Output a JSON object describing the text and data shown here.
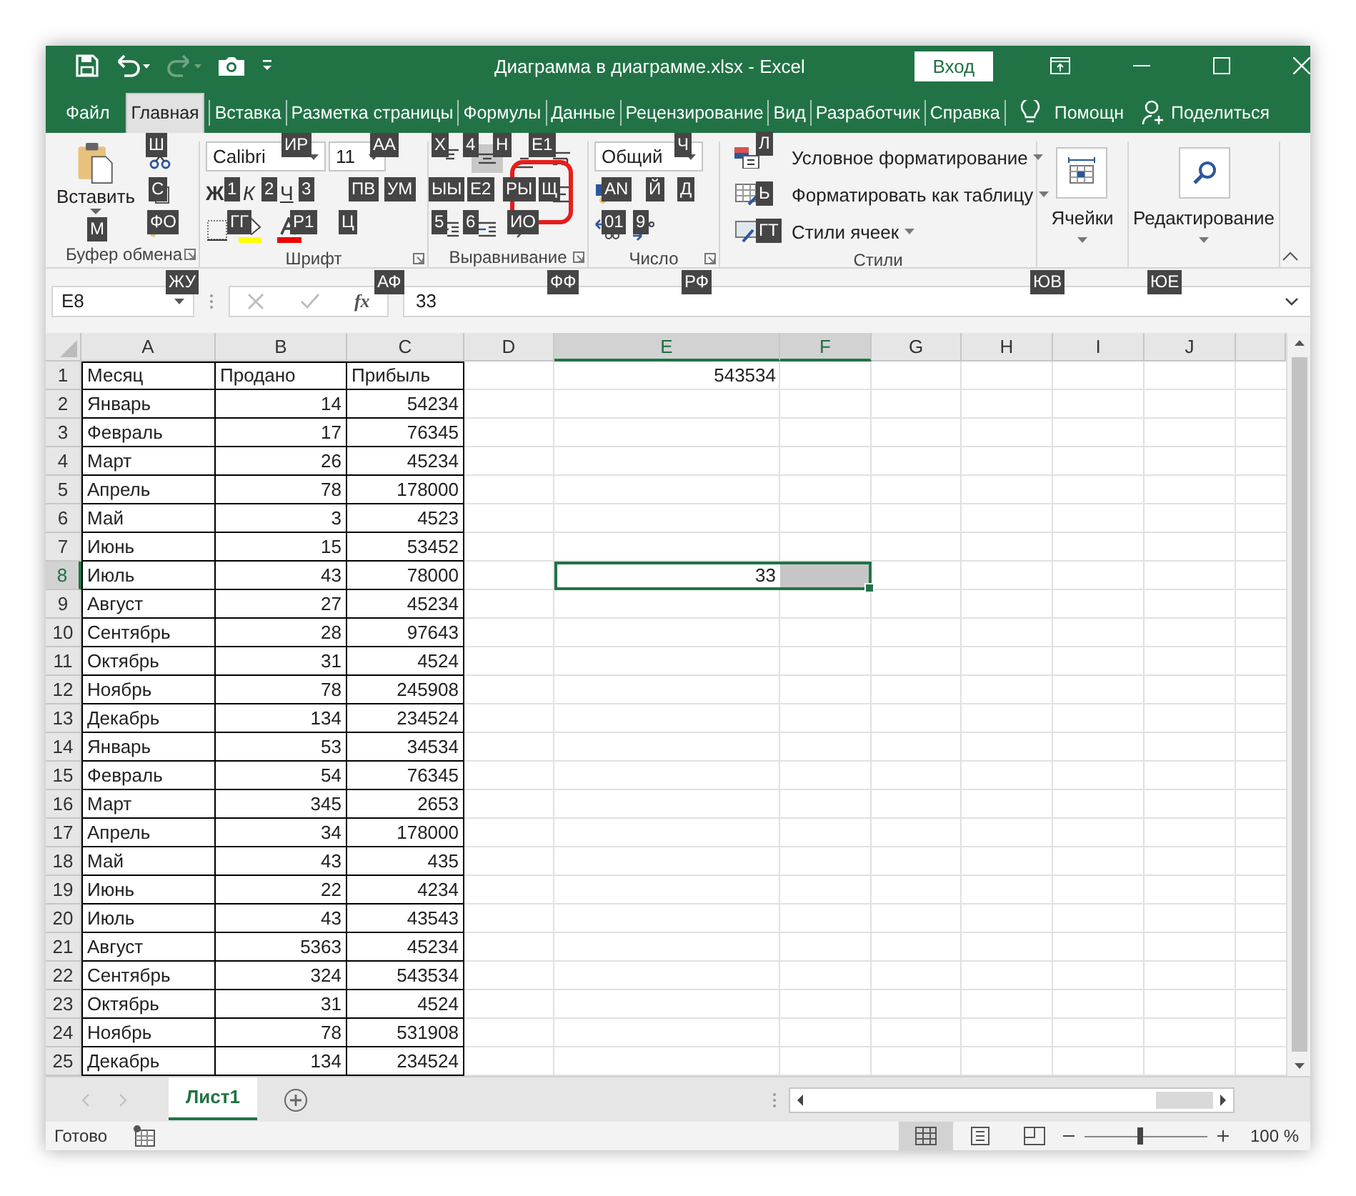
{
  "window": {
    "title": "Диаграмма в диаграмме.xlsx  -  Excel",
    "sign_in": "Вход"
  },
  "quick_access": [
    {
      "kind": "save",
      "disabled": false
    },
    {
      "kind": "undo",
      "disabled": false
    },
    {
      "kind": "redo",
      "disabled": true
    },
    {
      "kind": "camera",
      "disabled": false
    },
    {
      "kind": "customize",
      "disabled": false
    }
  ],
  "tabs": [
    {
      "label": "Файл",
      "selected": false
    },
    {
      "label": "Главная",
      "selected": true
    },
    {
      "label": "Вставка",
      "selected": false
    },
    {
      "label": "Разметка страницы",
      "selected": false
    },
    {
      "label": "Формулы",
      "selected": false
    },
    {
      "label": "Данные",
      "selected": false
    },
    {
      "label": "Рецензирование",
      "selected": false
    },
    {
      "label": "Вид",
      "selected": false
    },
    {
      "label": "Разработчик",
      "selected": false
    },
    {
      "label": "Справка",
      "selected": false
    }
  ],
  "help": "Помощн",
  "share": "Поделиться",
  "ribbon": {
    "clipboard": {
      "paste": "Вставить",
      "label": "Буфер обмена"
    },
    "font": {
      "name": "Calibri",
      "size": "11",
      "styles": [
        "Ж",
        "К",
        "Ч"
      ],
      "label": "Шрифт"
    },
    "alignment": {
      "label": "Выравнивание",
      "buttons": [
        {
          "kind": "top",
          "selected": false
        },
        {
          "kind": "middle",
          "selected": true
        },
        {
          "kind": "bottom",
          "selected": false
        },
        {
          "kind": "wrap",
          "selected": false
        },
        {
          "kind": "merge",
          "selected": false
        },
        {
          "kind": "indent-less",
          "selected": false
        },
        {
          "kind": "indent-more",
          "selected": false
        },
        {
          "kind": "orientation",
          "selected": false
        }
      ]
    },
    "number": {
      "format": "Общий",
      "label": "Число"
    },
    "styles": {
      "label": "Стили",
      "items": [
        {
          "kind": "conditional",
          "label": "Условное форматирование"
        },
        {
          "kind": "table",
          "label": "Форматировать как таблицу"
        },
        {
          "kind": "cell",
          "label": "Стили ячеек"
        }
      ]
    },
    "cells": {
      "label": "Ячейки"
    },
    "editing": {
      "label": "Редактирование"
    }
  },
  "key_tips": [
    {
      "label": "Ш"
    },
    {
      "label": "ИР"
    },
    {
      "label": "АА"
    },
    {
      "label": "Х"
    },
    {
      "label": "4"
    },
    {
      "label": "Н"
    },
    {
      "label": "Е1"
    },
    {
      "label": "Ч"
    },
    {
      "label": "Л"
    },
    {
      "label": "С"
    },
    {
      "label": "1"
    },
    {
      "label": "2"
    },
    {
      "label": "3"
    },
    {
      "label": "ПВ"
    },
    {
      "label": "УМ"
    },
    {
      "label": "ЫЫ"
    },
    {
      "label": "Е2"
    },
    {
      "label": "РЫ"
    },
    {
      "label": "Щ"
    },
    {
      "label": "AN"
    },
    {
      "label": "Й"
    },
    {
      "label": "Д"
    },
    {
      "label": "Ь"
    },
    {
      "label": "М"
    },
    {
      "label": "ФО"
    },
    {
      "label": "ГГ"
    },
    {
      "label": "Р1"
    },
    {
      "label": "Ц"
    },
    {
      "label": "5"
    },
    {
      "label": "6"
    },
    {
      "label": "ИО"
    },
    {
      "label": "01"
    },
    {
      "label": "9"
    },
    {
      "label": "ГТ"
    },
    {
      "label": "ЖУ"
    },
    {
      "label": "АФ"
    },
    {
      "label": "ФФ"
    },
    {
      "label": "РФ"
    },
    {
      "label": "ЮВ"
    },
    {
      "label": "ЮЕ"
    }
  ],
  "formula_bar": {
    "name_box": "E8",
    "fx": "fx",
    "value": "33"
  },
  "sheet": {
    "columns": [
      {
        "label": "A",
        "selected": false
      },
      {
        "label": "B",
        "selected": false
      },
      {
        "label": "C",
        "selected": false
      },
      {
        "label": "D",
        "selected": false
      },
      {
        "label": "E",
        "selected": true
      },
      {
        "label": "F",
        "selected": true
      },
      {
        "label": "G",
        "selected": false
      },
      {
        "label": "H",
        "selected": false
      },
      {
        "label": "I",
        "selected": false
      },
      {
        "label": "J",
        "selected": false
      }
    ],
    "rows": [
      {
        "number": "1",
        "month": "Месяц",
        "sold": "Продано",
        "profit": "Прибыль",
        "e": "543534",
        "selected": false
      },
      {
        "number": "2",
        "month": "Январь",
        "sold": "14",
        "profit": "54234",
        "selected": false
      },
      {
        "number": "3",
        "month": "Февраль",
        "sold": "17",
        "profit": "76345",
        "selected": false
      },
      {
        "number": "4",
        "month": "Март",
        "sold": "26",
        "profit": "45234",
        "selected": false
      },
      {
        "number": "5",
        "month": "Апрель",
        "sold": "78",
        "profit": "178000",
        "selected": false
      },
      {
        "number": "6",
        "month": "Май",
        "sold": "3",
        "profit": "4523",
        "selected": false
      },
      {
        "number": "7",
        "month": "Июнь",
        "sold": "15",
        "profit": "53452",
        "selected": false
      },
      {
        "number": "8",
        "month": "Июль",
        "sold": "43",
        "profit": "78000",
        "e": "33",
        "selected": true
      },
      {
        "number": "9",
        "month": "Август",
        "sold": "27",
        "profit": "45234",
        "selected": false
      },
      {
        "number": "10",
        "month": "Сентябрь",
        "sold": "28",
        "profit": "97643",
        "selected": false
      },
      {
        "number": "11",
        "month": "Октябрь",
        "sold": "31",
        "profit": "4524",
        "selected": false
      },
      {
        "number": "12",
        "month": "Ноябрь",
        "sold": "78",
        "profit": "245908",
        "selected": false
      },
      {
        "number": "13",
        "month": "Декабрь",
        "sold": "134",
        "profit": "234524",
        "selected": false
      },
      {
        "number": "14",
        "month": "Январь",
        "sold": "53",
        "profit": "34534",
        "selected": false
      },
      {
        "number": "15",
        "month": "Февраль",
        "sold": "54",
        "profit": "76345",
        "selected": false
      },
      {
        "number": "16",
        "month": "Март",
        "sold": "345",
        "profit": "2653",
        "selected": false
      },
      {
        "number": "17",
        "month": "Апрель",
        "sold": "34",
        "profit": "178000",
        "selected": false
      },
      {
        "number": "18",
        "month": "Май",
        "sold": "43",
        "profit": "435",
        "selected": false
      },
      {
        "number": "19",
        "month": "Июнь",
        "sold": "22",
        "profit": "4234",
        "selected": false
      },
      {
        "number": "20",
        "month": "Июль",
        "sold": "43",
        "profit": "43543",
        "selected": false
      },
      {
        "number": "21",
        "month": "Август",
        "sold": "5363",
        "profit": "45234",
        "selected": false
      },
      {
        "number": "22",
        "month": "Сентябрь",
        "sold": "324",
        "profit": "543534",
        "selected": false
      },
      {
        "number": "23",
        "month": "Октябрь",
        "sold": "31",
        "profit": "4524",
        "selected": false
      },
      {
        "number": "24",
        "month": "Ноябрь",
        "sold": "78",
        "profit": "531908",
        "selected": false
      },
      {
        "number": "25",
        "month": "Декабрь",
        "sold": "134",
        "profit": "234524",
        "selected": false
      }
    ]
  },
  "sheet_tabs": [
    {
      "label": "Лист1",
      "selected": true
    }
  ],
  "status": {
    "text": "Готово",
    "views": [
      {
        "kind": "normal",
        "selected": true
      },
      {
        "kind": "page-layout",
        "selected": false
      },
      {
        "kind": "page-break",
        "selected": false
      }
    ],
    "zoom": {
      "level": 0.45,
      "reading": "100 %"
    }
  }
}
